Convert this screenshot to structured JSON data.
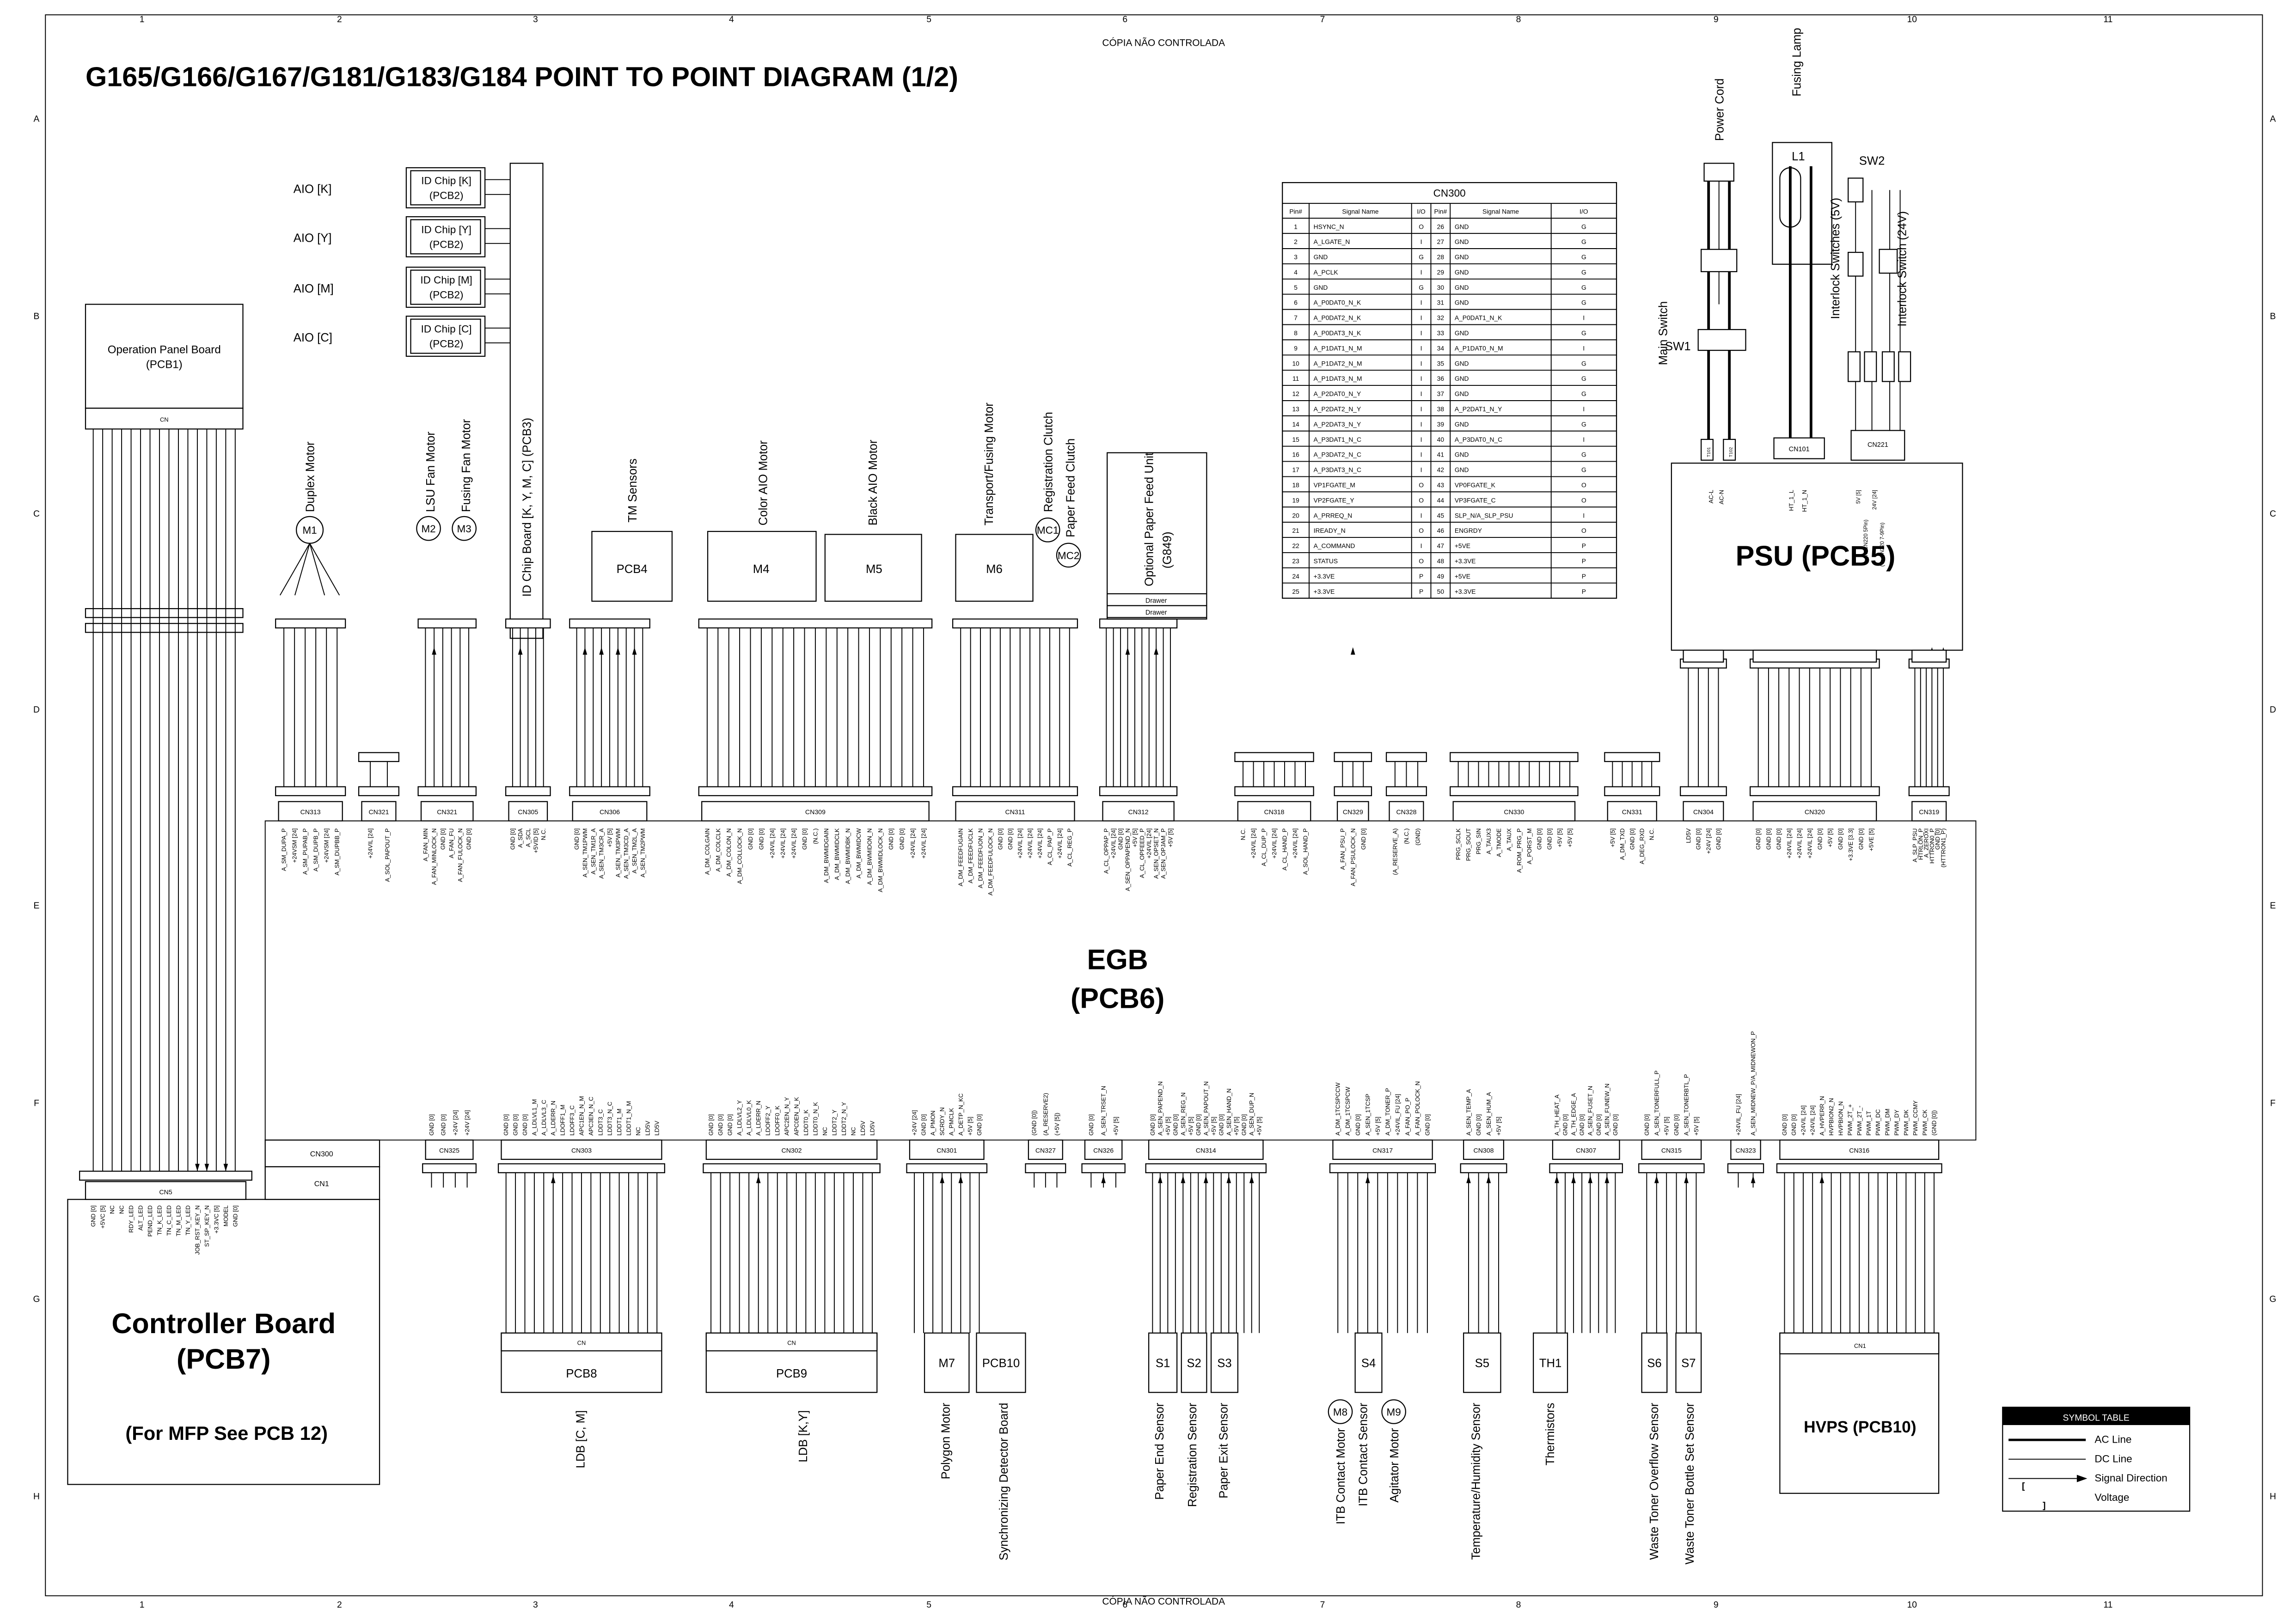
{
  "header": {
    "title": "G165/G166/G167/G181/G183/G184 POINT TO POINT DIAGRAM (1/2)",
    "watermark_top": "CÓPIA NÃO CONTROLADA",
    "watermark_bottom": "CÓPIA NÃO CONTROLADA",
    "columns": [
      "1",
      "2",
      "3",
      "4",
      "5",
      "6",
      "7",
      "8",
      "9",
      "10",
      "11"
    ],
    "rows": [
      "A",
      "B",
      "C",
      "D",
      "E",
      "F",
      "G",
      "H"
    ]
  },
  "operation_panel": {
    "name": "Operation Panel Board",
    "pcb": "(PCB1)",
    "connector": "CN"
  },
  "aio_chips": [
    {
      "label": "AIO [K]",
      "chip": "ID Chip [K]",
      "pcb": "(PCB2)"
    },
    {
      "label": "AIO [Y]",
      "chip": "ID Chip [Y]",
      "pcb": "(PCB2)"
    },
    {
      "label": "AIO [M]",
      "chip": "ID Chip [M]",
      "pcb": "(PCB2)"
    },
    {
      "label": "AIO [C]",
      "chip": "ID Chip [C]",
      "pcb": "(PCB2)"
    }
  ],
  "top_components": {
    "duplex_motor": {
      "label": "Duplex Motor",
      "id": "M1"
    },
    "lsu_fan_motor": {
      "label": "LSU Fan Motor",
      "id": "M2"
    },
    "fusing_fan_motor": {
      "label": "Fusing Fan Motor",
      "id": "M3"
    },
    "id_chip_board": {
      "label": "ID Chip Board [K, Y, M, C] (PCB3)"
    },
    "tm_sensors": {
      "label": "TM Sensors",
      "id": "PCB4"
    },
    "color_aio_motor": {
      "label": "Color AIO Motor",
      "id": "M4"
    },
    "black_aio_motor": {
      "label": "Black AIO Motor",
      "id": "M5"
    },
    "transport_fusing_motor": {
      "label": "Transport/Fusing Motor",
      "id": "M6"
    },
    "registration_clutch": {
      "label": "Registration Clutch",
      "id": "MC1"
    },
    "paper_feed_clutch": {
      "label": "Paper Feed Clutch",
      "id": "MC2"
    },
    "optional_paper_feed": {
      "label": "Optional Paper Feed Unit",
      "model": "(G849)",
      "drawers": [
        "Drawer",
        "Drawer"
      ]
    }
  },
  "psu": {
    "name": "PSU (PCB5)",
    "power_cord": "Power Cord",
    "fusing_lamp": "Fusing Lamp",
    "lamp_id": "L1",
    "main_switch": "Main Switch",
    "sw1": "SW1",
    "sw2": "SW2",
    "interlock_5v": "Interlock Switches (5V)",
    "interlock_24v": "Interlock Switch (24V)",
    "terminals": [
      "T101",
      "T102"
    ],
    "cn101": "CN101",
    "cn221": "CN221",
    "pin_labels": [
      "AC-L",
      "AC-N",
      "HT_1_L",
      "HT_1_N",
      "5V [5]",
      "(To CN220 5Pin)",
      "24V [24]",
      "(To CN220 7-9Pin)"
    ]
  },
  "cn300_table": {
    "title": "CN300",
    "headers": [
      "Pin#",
      "Signal Name",
      "I/O",
      "Pin#",
      "Signal Name",
      "I/O"
    ],
    "rows": [
      [
        "1",
        "HSYNC_N",
        "O",
        "26",
        "GND",
        "G"
      ],
      [
        "2",
        "A_LGATE_N",
        "I",
        "27",
        "GND",
        "G"
      ],
      [
        "3",
        "GND",
        "G",
        "28",
        "GND",
        "G"
      ],
      [
        "4",
        "A_PCLK",
        "I",
        "29",
        "GND",
        "G"
      ],
      [
        "5",
        "GND",
        "G",
        "30",
        "GND",
        "G"
      ],
      [
        "6",
        "A_P0DAT0_N_K",
        "I",
        "31",
        "GND",
        "G"
      ],
      [
        "7",
        "A_P0DAT2_N_K",
        "I",
        "32",
        "A_P0DAT1_N_K",
        "I"
      ],
      [
        "8",
        "A_P0DAT3_N_K",
        "I",
        "33",
        "GND",
        "G"
      ],
      [
        "9",
        "A_P1DAT1_N_M",
        "I",
        "34",
        "A_P1DAT0_N_M",
        "I"
      ],
      [
        "10",
        "A_P1DAT2_N_M",
        "I",
        "35",
        "GND",
        "G"
      ],
      [
        "11",
        "A_P1DAT3_N_M",
        "I",
        "36",
        "GND",
        "G"
      ],
      [
        "12",
        "A_P2DAT0_N_Y",
        "I",
        "37",
        "GND",
        "G"
      ],
      [
        "13",
        "A_P2DAT2_N_Y",
        "I",
        "38",
        "A_P2DAT1_N_Y",
        "I"
      ],
      [
        "14",
        "A_P2DAT3_N_Y",
        "I",
        "39",
        "GND",
        "G"
      ],
      [
        "15",
        "A_P3DAT1_N_C",
        "I",
        "40",
        "A_P3DAT0_N_C",
        "I"
      ],
      [
        "16",
        "A_P3DAT2_N_C",
        "I",
        "41",
        "GND",
        "G"
      ],
      [
        "17",
        "A_P3DAT3_N_C",
        "I",
        "42",
        "GND",
        "G"
      ],
      [
        "18",
        "VP1FGATE_M",
        "O",
        "43",
        "VP0FGATE_K",
        "O"
      ],
      [
        "19",
        "VP2FGATE_Y",
        "O",
        "44",
        "VP3FGATE_C",
        "O"
      ],
      [
        "20",
        "A_PRREQ_N",
        "I",
        "45",
        "SLP_N/A_SLP_PSU",
        "I"
      ],
      [
        "21",
        "IREADY_N",
        "O",
        "46",
        "ENGRDY",
        "O"
      ],
      [
        "22",
        "A_COMMAND",
        "I",
        "47",
        "+5VE",
        "P"
      ],
      [
        "23",
        "STATUS",
        "O",
        "48",
        "+3.3VE",
        "P"
      ],
      [
        "24",
        "+3.3VE",
        "P",
        "49",
        "+5VE",
        "P"
      ],
      [
        "25",
        "+3.3VE",
        "P",
        "50",
        "+3.3VE",
        "P"
      ]
    ]
  },
  "egb": {
    "name": "EGB",
    "pcb": "(PCB6)",
    "top_connectors": [
      {
        "name": "CN313",
        "signals": [
          "A_SM_DUPA_P",
          "+24VSM [24]",
          "A_SM_PUPAB_P",
          "A_SM_DUPB_P",
          "+24VSM [24]",
          "A_SM_DUPBB_P"
        ]
      },
      {
        "name": "CN321",
        "signals": [
          "+24VIL [24]",
          "A_SOL_PAPOUT_P"
        ]
      },
      {
        "name": "CN321",
        "signals": [
          "A_FAN_MIN",
          "A_FAN_MINLOCK_N",
          "GND [0]",
          "A_FAN_FU",
          "A_FAN_FULOCK_N",
          "GND [0]"
        ]
      },
      {
        "name": "CN305",
        "signals": [
          "GND [0]",
          "A_SDA",
          "A_SCL",
          "+5VID [5]",
          "N.C."
        ]
      },
      {
        "name": "CN306",
        "signals": [
          "GND [0]",
          "A_SEN_TM1PWM",
          "A_SEN_TM1R_A",
          "A_SEN_TM3CR_A",
          "+5V [5]",
          "A_SEN_TM3PWM",
          "A_SEN_TM3CD_A",
          "A_SEN_TM2L_A",
          "A_SEN_TM2PWM"
        ]
      },
      {
        "name": "CN309",
        "signals": [
          "A_DM_COLGAIN",
          "A_DM_COLCLK",
          "A_DM_COLON_N",
          "A_DM_COLLOCK_N",
          "GND [0]",
          "GND [0]",
          "+24VIL [24]",
          "+24VIL [24]",
          "+24VIL [24]",
          "GND [0]",
          "(N.C.)",
          "A_DM_BWMIDGAIN",
          "A_DM_BWMIDCLK",
          "A_DM_BWMIDBK_N",
          "A_DM_BWMIDCW",
          "A_DM_BWMIDON_N",
          "A_DM_BWMIDLOCK_N",
          "GND [0]",
          "GND [0]",
          "+24VIL [24]",
          "+24VIL [24]"
        ]
      },
      {
        "name": "CN311",
        "signals": [
          "A_DM_FEEDFUGAIN",
          "A_DM_FEEDFUCLK",
          "A_DM_FEEDFUON_N",
          "A_DM_FEEDFULOCK_N",
          "GND [0]",
          "GND [0]",
          "+24VIL [24]",
          "+24VIL [24]",
          "+24VIL [24]",
          "A_CL_PAP_P",
          "+24VIL [24]",
          "A_CL_REG_P"
        ]
      },
      {
        "name": "CN312",
        "signals": [
          "A_CL_OPPAP_P",
          "+24VIL [24]",
          "GND [0]",
          "A_SEN_OPPAPEND_N",
          "+5V [5]",
          "A_CL_OPFEED_P",
          "+24VIL [24]",
          "A_SEN_OPSET_N",
          "A_SEN_OPJAM_P",
          "+5V [5]"
        ]
      },
      {
        "name": "CN318",
        "signals": [
          "N.C.",
          "+24VIL [24]",
          "A_CL_DUP_P",
          "+24VIL [24]",
          "A_CL_HAND_P",
          "+24VIL [24]",
          "A_SOL_HAND_P"
        ]
      },
      {
        "name": "CN329",
        "signals": [
          "A_FAN_PSU_P",
          "A_FAN_PSULOCK_N",
          "GND [0]"
        ]
      },
      {
        "name": "CN328",
        "signals": [
          "(A_RESERVE_A)",
          "(N.C.)",
          "(GND)"
        ]
      },
      {
        "name": "CN330",
        "signals": [
          "PRG_SCLK",
          "PRG_SOUT",
          "PRG_SIN",
          "A_TAUX3",
          "A_TMODE",
          "A_TAUX",
          "A_ROM_PRG_P",
          "A_PORST_M",
          "GND [0]",
          "GND [0]",
          "+5V [5]",
          "+5V [5]"
        ]
      },
      {
        "name": "CN331",
        "signals": [
          "+5V [5]",
          "A_DM_TXD",
          "GND [0]",
          "A_DEG_RXD",
          "N.C."
        ]
      },
      {
        "name": "CN304",
        "signals": [
          "LD5V",
          "GND [0]",
          "+24V [24]",
          "GND [0]"
        ]
      },
      {
        "name": "CN320",
        "signals": [
          "GND [0]",
          "GND [0]",
          "GND [0]",
          "+24VIL [24]",
          "+24VIL [24]",
          "+24VIL [24]",
          "GND [0]",
          "+5V [5]",
          "GND [0]",
          "+3.3VE [3.3]",
          "GND [0]",
          "+5VE [5]"
        ]
      },
      {
        "name": "CN319",
        "signals": [
          "A_SLP_PSU",
          "HTRLON_P",
          "A_ZEROXI",
          "HTTRON0_P",
          "GND [0]",
          "(HTTRON1_P)"
        ]
      }
    ],
    "bottom_connectors": [
      {
        "name": "CN325",
        "signals": [
          "GND [0]",
          "GND [0]",
          "+24V [24]",
          "+24V [24]"
        ]
      },
      {
        "name": "CN303",
        "signals": [
          "GND [0]",
          "GND [0]",
          "GND [0]",
          "A_LDLVL1_M",
          "A_LDLVL3_C",
          "A_LDERR_N",
          "LDOFF1_M",
          "LDOFF3_C",
          "APC1EN_N_M",
          "APC3EN_N_C",
          "LDDT3_C",
          "LDDT3_N_C",
          "LDDT1_M",
          "LDDT1_N_M",
          "NC",
          "LD5V",
          "LD5V"
        ]
      },
      {
        "name": "CN302",
        "signals": [
          "GND [0]",
          "GND [0]",
          "GND [0]",
          "A_LDLVL2_Y",
          "A_LDLVL0_K",
          "A_LDERR_N",
          "LDOFF2_Y",
          "LDOFF0_K",
          "APC2EN_N_Y",
          "APC0EN_N_K",
          "LDDT0_K",
          "LDDT0_N_K",
          "NC",
          "LDDT2_Y",
          "LDDT2_N_Y",
          "NC",
          "LD5V",
          "LD5V"
        ]
      },
      {
        "name": "CN301",
        "signals": [
          "+24V [24]",
          "GND [0]",
          "A_PMON",
          "SCRDY_N",
          "A_PMCLK",
          "A_DETP_N_KC",
          "+5V [5]",
          "GND [0]"
        ]
      },
      {
        "name": "CN327",
        "signals": [
          "(GND [0])",
          "(A_RESERVE2)",
          "(+5V [5])"
        ]
      },
      {
        "name": "CN326",
        "signals": [
          "GND [0]",
          "A_SEN_TRSET_N",
          "+5V [5]"
        ]
      },
      {
        "name": "CN314",
        "signals": [
          "GND [0]",
          "A_SEN_PAPEND_N",
          "+5V [5]",
          "GND [0]",
          "A_SEN_REG_N",
          "+5V [5]",
          "GND [0]",
          "A_SEN_PAPOUT_N",
          "+5V [5]",
          "GND [0]",
          "A_SEN_HAND_N",
          "+5V [5]",
          "GND [0]",
          "A_SEN_DUP_N",
          "+5V [5]"
        ]
      },
      {
        "name": "CN317",
        "signals": [
          "A_DM_1TCSPCCW",
          "A_DM_1TCSPCW",
          "GND [0]",
          "A_SEN_1TCSP",
          "+5V [5]",
          "A_DM_TONER_P",
          "+24VIL_FU [24]",
          "A_FAN_PO_P",
          "A_FAN_POLOCK_N",
          "GND [0]"
        ]
      },
      {
        "name": "CN308",
        "signals": [
          "A_SEN_TEMP_A",
          "GND [0]",
          "A_SEN_HUM_A",
          "+5V [5]"
        ]
      },
      {
        "name": "CN307",
        "signals": [
          "A_TH_HEAT_A",
          "GND [0]",
          "A_TH_EDGE_A",
          "GND [0]",
          "A_SEN_FUSET_N",
          "GND [0]",
          "A_SEN_FUNEW_N",
          "GND [0]"
        ]
      },
      {
        "name": "CN315",
        "signals": [
          "GND [0]",
          "A_SEN_TONERFULL_P",
          "+5V [5]",
          "GND [0]",
          "A_SEN_TONERBTL_P",
          "+5V [5]"
        ]
      },
      {
        "name": "CN323",
        "signals": [
          "+24VIL_FU [24]",
          "A_SEN_MIDNEW_P/A_MIDNEWON_P"
        ]
      },
      {
        "name": "CN316",
        "signals": [
          "GND [0]",
          "GND [0]",
          "+24VIL [24]",
          "+24VIL [24]",
          "A_HVPERR_N",
          "HVPBION2_N",
          "HVPBION_N",
          "PWM_2T_+",
          "PWM_2T_-",
          "PWM_1T",
          "PWM_DC",
          "PWM_DM",
          "PWM_DY",
          "PWM_DK",
          "PWM_CCMY",
          "PWM_CK",
          "(GND [0])"
        ]
      }
    ]
  },
  "controller": {
    "name": "Controller Board",
    "pcb": "(PCB7)",
    "note": "(For MFP See PCB 12)",
    "cn5": {
      "name": "CN5",
      "signals": [
        "GND [0]",
        "+5VC [5]",
        "NC",
        "NC",
        "RDY_LED",
        "ALT_LED",
        "PEND_LED",
        "TN_K_LED",
        "TN_C_LED",
        "TN_M_LED",
        "TN_Y_LED",
        "JOB_RST_KEY_N",
        "ST_SP_KEY_N",
        "+3.3VC [5]",
        "MODEL",
        "GND [0]"
      ]
    },
    "cn300": "CN300",
    "cn1": "CN1"
  },
  "bottom_components": {
    "pcb8": {
      "id": "PCB8",
      "label": "LDB [C, M]",
      "cn": "CN"
    },
    "pcb9": {
      "id": "PCB9",
      "label": "LDB [K,Y]",
      "cn": "CN"
    },
    "m7": {
      "id": "M7",
      "label": "Polygon Motor"
    },
    "pcb10": {
      "id": "PCB10",
      "label": "Synchronizing Detector Board"
    },
    "s1": {
      "id": "S1",
      "label": "Paper End Sensor"
    },
    "s2": {
      "id": "S2",
      "label": "Registration Sensor"
    },
    "s3": {
      "id": "S3",
      "label": "Paper Exit Sensor"
    },
    "m8": {
      "id": "M8",
      "label": "ITB Contact Motor"
    },
    "s4": {
      "id": "S4",
      "label": "ITB Contact Sensor"
    },
    "m9": {
      "id": "M9",
      "label": "Agitator Motor"
    },
    "s5": {
      "id": "S5",
      "label": "Temperature/Humidity Sensor"
    },
    "th1": {
      "id": "TH1",
      "label": "Thermistors"
    },
    "s6": {
      "id": "S6",
      "label": "Waste Toner Overflow Sensor"
    },
    "s7": {
      "id": "S7",
      "label": "Waste Toner Bottle Set Sensor"
    },
    "hvps": {
      "id": "HVPS (PCB10)",
      "cn": "CN1"
    }
  },
  "symbol_table": {
    "title": "SYMBOL   TABLE",
    "items": [
      "AC Line",
      "DC Line",
      "Signal Direction",
      "Voltage"
    ],
    "voltage_glyphs": [
      "[",
      "]"
    ]
  }
}
